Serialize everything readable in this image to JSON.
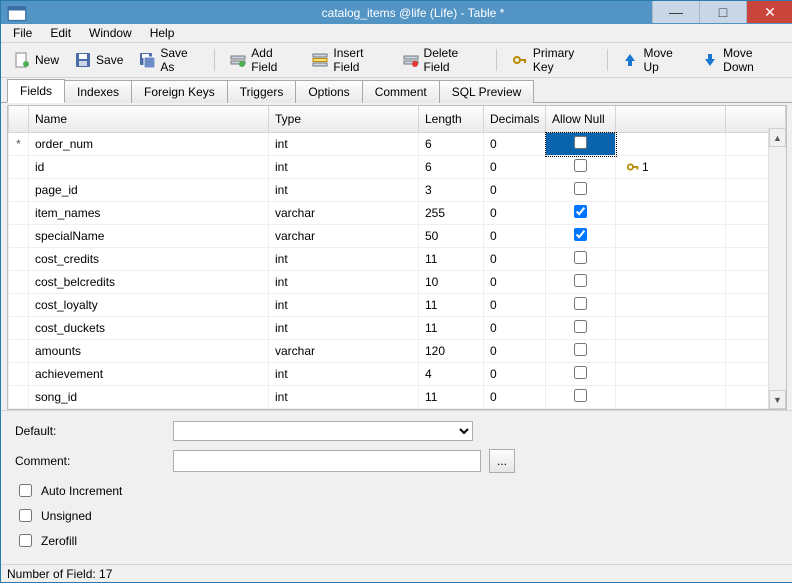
{
  "window": {
    "title": "catalog_items @life (Life) - Table *"
  },
  "menu": {
    "file": "File",
    "edit": "Edit",
    "window": "Window",
    "help": "Help"
  },
  "toolbar": {
    "new": "New",
    "save": "Save",
    "save_as": "Save As",
    "add_field": "Add Field",
    "insert_field": "Insert Field",
    "delete_field": "Delete Field",
    "primary_key": "Primary Key",
    "move_up": "Move Up",
    "move_down": "Move Down"
  },
  "tabs": {
    "fields": "Fields",
    "indexes": "Indexes",
    "foreign_keys": "Foreign Keys",
    "triggers": "Triggers",
    "options": "Options",
    "comment": "Comment",
    "sql_preview": "SQL Preview"
  },
  "columns": {
    "name": "Name",
    "type": "Type",
    "length": "Length",
    "decimals": "Decimals",
    "allow_null": "Allow Null"
  },
  "rows": [
    {
      "marker": "*",
      "name": "order_num",
      "type": "int",
      "length": "6",
      "decimals": "0",
      "allow_null": false,
      "selected": true,
      "primary": false
    },
    {
      "marker": "",
      "name": "id",
      "type": "int",
      "length": "6",
      "decimals": "0",
      "allow_null": false,
      "selected": false,
      "primary": true,
      "key_index": "1"
    },
    {
      "marker": "",
      "name": "page_id",
      "type": "int",
      "length": "3",
      "decimals": "0",
      "allow_null": false,
      "selected": false,
      "primary": false
    },
    {
      "marker": "",
      "name": "item_names",
      "type": "varchar",
      "length": "255",
      "decimals": "0",
      "allow_null": true,
      "selected": false,
      "primary": false
    },
    {
      "marker": "",
      "name": "specialName",
      "type": "varchar",
      "length": "50",
      "decimals": "0",
      "allow_null": true,
      "selected": false,
      "primary": false
    },
    {
      "marker": "",
      "name": "cost_credits",
      "type": "int",
      "length": "11",
      "decimals": "0",
      "allow_null": false,
      "selected": false,
      "primary": false
    },
    {
      "marker": "",
      "name": "cost_belcredits",
      "type": "int",
      "length": "10",
      "decimals": "0",
      "allow_null": false,
      "selected": false,
      "primary": false
    },
    {
      "marker": "",
      "name": "cost_loyalty",
      "type": "int",
      "length": "11",
      "decimals": "0",
      "allow_null": false,
      "selected": false,
      "primary": false
    },
    {
      "marker": "",
      "name": "cost_duckets",
      "type": "int",
      "length": "11",
      "decimals": "0",
      "allow_null": false,
      "selected": false,
      "primary": false
    },
    {
      "marker": "",
      "name": "amounts",
      "type": "varchar",
      "length": "120",
      "decimals": "0",
      "allow_null": false,
      "selected": false,
      "primary": false
    },
    {
      "marker": "",
      "name": "achievement",
      "type": "int",
      "length": "4",
      "decimals": "0",
      "allow_null": false,
      "selected": false,
      "primary": false
    },
    {
      "marker": "",
      "name": "song_id",
      "type": "int",
      "length": "11",
      "decimals": "0",
      "allow_null": false,
      "selected": false,
      "primary": false
    }
  ],
  "form": {
    "default_label": "Default:",
    "comment_label": "Comment:",
    "auto_increment": "Auto Increment",
    "unsigned": "Unsigned",
    "zerofill": "Zerofill",
    "ellipsis": "..."
  },
  "status": {
    "field_count": "Number of Field: 17"
  }
}
